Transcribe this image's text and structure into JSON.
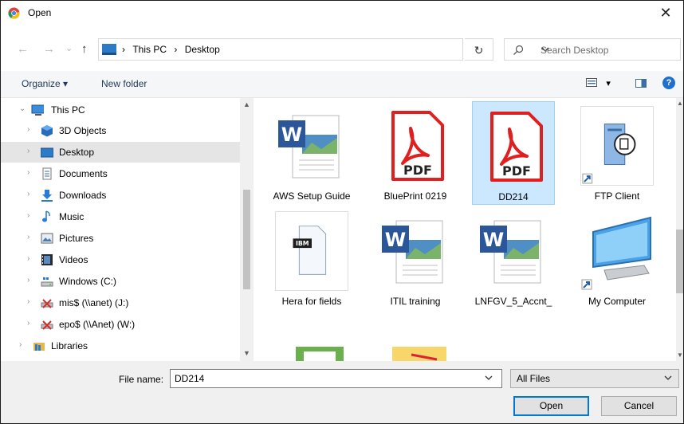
{
  "window": {
    "title": "Open",
    "close_glyph": "✕"
  },
  "nav": {
    "back": "←",
    "forward": "→",
    "recent": "⌄",
    "up": "↑"
  },
  "address": {
    "crumbs": [
      "This PC",
      "Desktop"
    ],
    "separator": "›",
    "refresh": "↻"
  },
  "search": {
    "placeholder": "Search Desktop"
  },
  "toolbar": {
    "organize_label": "Organize ▾",
    "new_folder_label": "New folder",
    "view_arrow": "▾",
    "help": "?"
  },
  "tree": [
    {
      "label": "This PC",
      "icon": "pc-icon",
      "expanded": true
    },
    {
      "label": "3D Objects",
      "icon": "cube-icon"
    },
    {
      "label": "Desktop",
      "icon": "desktop-icon",
      "hover": true
    },
    {
      "label": "Documents",
      "icon": "document-icon"
    },
    {
      "label": "Downloads",
      "icon": "download-icon"
    },
    {
      "label": "Music",
      "icon": "music-icon"
    },
    {
      "label": "Pictures",
      "icon": "picture-icon"
    },
    {
      "label": "Videos",
      "icon": "video-icon"
    },
    {
      "label": "Windows (C:)",
      "icon": "drive-icon"
    },
    {
      "label": "mis$ (\\\\anet) (J:)",
      "icon": "network-drive-icon"
    },
    {
      "label": "epo$ (\\\\Anet) (W:)",
      "icon": "network-drive-icon"
    },
    {
      "label": "Libraries",
      "icon": "library-icon",
      "expanded": false
    }
  ],
  "files": [
    {
      "name": "AWS Setup Guide",
      "icon": "word-icon"
    },
    {
      "name": "BluePrint 0219",
      "icon": "pdf-icon",
      "badge": "PDF"
    },
    {
      "name": "DD214",
      "icon": "pdf-icon",
      "badge": "PDF",
      "selected": true
    },
    {
      "name": "FTP Client",
      "icon": "ftp-shortcut-icon"
    },
    {
      "name": "Hera for fields",
      "icon": "ibm-file-icon",
      "badge": "IBM"
    },
    {
      "name": "ITIL training",
      "icon": "word-icon"
    },
    {
      "name": "LNFGV_5_Accnt_",
      "icon": "word-icon"
    },
    {
      "name": "My Computer",
      "icon": "computer-shortcut-icon"
    }
  ],
  "footer": {
    "file_name_label": "File name:",
    "file_name_value": "DD214",
    "filter_value": "All Files",
    "open_label": "Open",
    "cancel_label": "Cancel"
  },
  "colors": {
    "accent": "#0078d7",
    "selection": "#cce8ff",
    "pdf_red": "#e02020"
  }
}
